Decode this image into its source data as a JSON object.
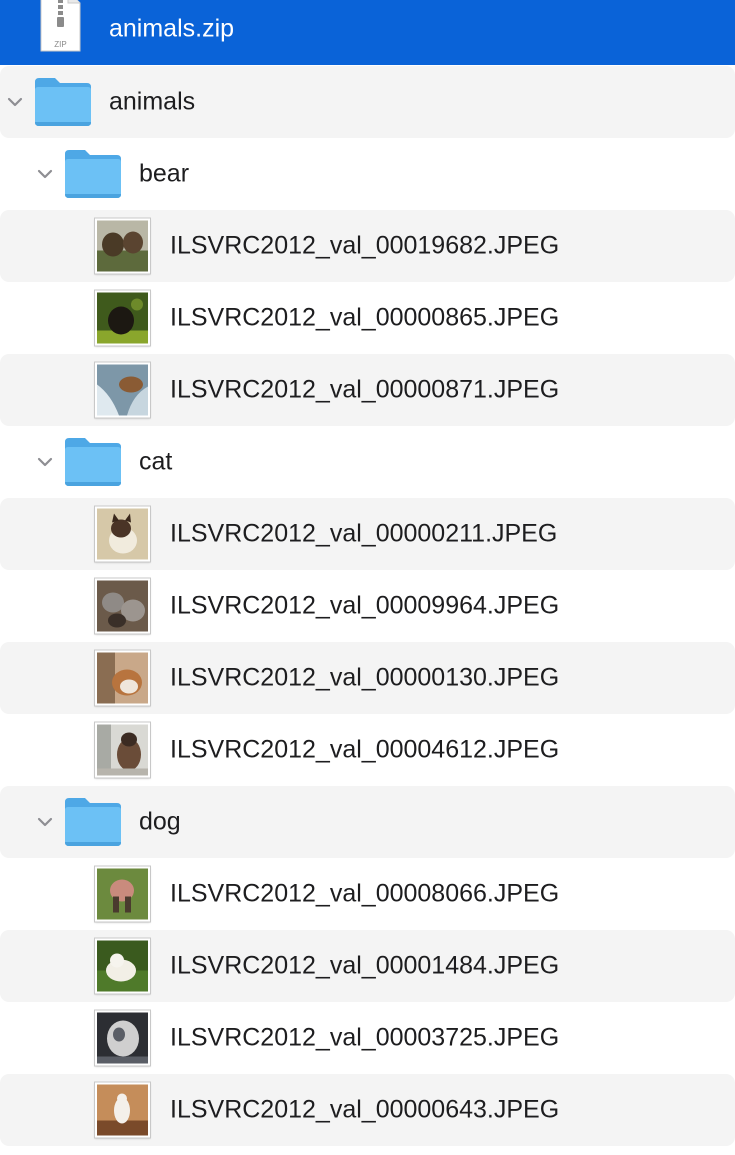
{
  "archive": {
    "name": "animals.zip",
    "icon": "zip-file-icon",
    "badge": "ZIP"
  },
  "root": {
    "name": "animals",
    "icon": "folder-icon",
    "expanded": true
  },
  "folders": [
    {
      "name": "bear",
      "expanded": true,
      "files": [
        {
          "name": "ILSVRC2012_val_00019682.JPEG",
          "thumb_colors": [
            "#5d6a3c",
            "#4a3a26",
            "#b9b7a6"
          ]
        },
        {
          "name": "ILSVRC2012_val_00000865.JPEG",
          "thumb_colors": [
            "#3f5a1c",
            "#1c1812",
            "#8aa62c"
          ]
        },
        {
          "name": "ILSVRC2012_val_00000871.JPEG",
          "thumb_colors": [
            "#7d97a8",
            "#8a5b34",
            "#dfe9ef"
          ]
        }
      ]
    },
    {
      "name": "cat",
      "expanded": true,
      "files": [
        {
          "name": "ILSVRC2012_val_00000211.JPEG",
          "thumb_colors": [
            "#d6c8a8",
            "#4a3426",
            "#f1ebdd"
          ]
        },
        {
          "name": "ILSVRC2012_val_00009964.JPEG",
          "thumb_colors": [
            "#6b5a4a",
            "#8f8a86",
            "#3a2f28"
          ]
        },
        {
          "name": "ILSVRC2012_val_00000130.JPEG",
          "thumb_colors": [
            "#c9a889",
            "#b8743e",
            "#efe6db"
          ]
        },
        {
          "name": "ILSVRC2012_val_00004612.JPEG",
          "thumb_colors": [
            "#d9d9d4",
            "#6a4c38",
            "#3b2b22"
          ]
        }
      ]
    },
    {
      "name": "dog",
      "expanded": true,
      "files": [
        {
          "name": "ILSVRC2012_val_00008066.JPEG",
          "thumb_colors": [
            "#6c8a3e",
            "#c98b7d",
            "#4a3b2e"
          ]
        },
        {
          "name": "ILSVRC2012_val_00001484.JPEG",
          "thumb_colors": [
            "#4f7a2a",
            "#f2efe6",
            "#3a5a1e"
          ]
        },
        {
          "name": "ILSVRC2012_val_00003725.JPEG",
          "thumb_colors": [
            "#5a5e66",
            "#cfcfcf",
            "#2c2e33"
          ]
        },
        {
          "name": "ILSVRC2012_val_00000643.JPEG",
          "thumb_colors": [
            "#c58d5a",
            "#f4f0ea",
            "#7a4a2a"
          ]
        }
      ]
    }
  ],
  "colors": {
    "selection": "#0a63d8",
    "stripe": "#f4f4f4",
    "folder": "#5ab6f0"
  }
}
